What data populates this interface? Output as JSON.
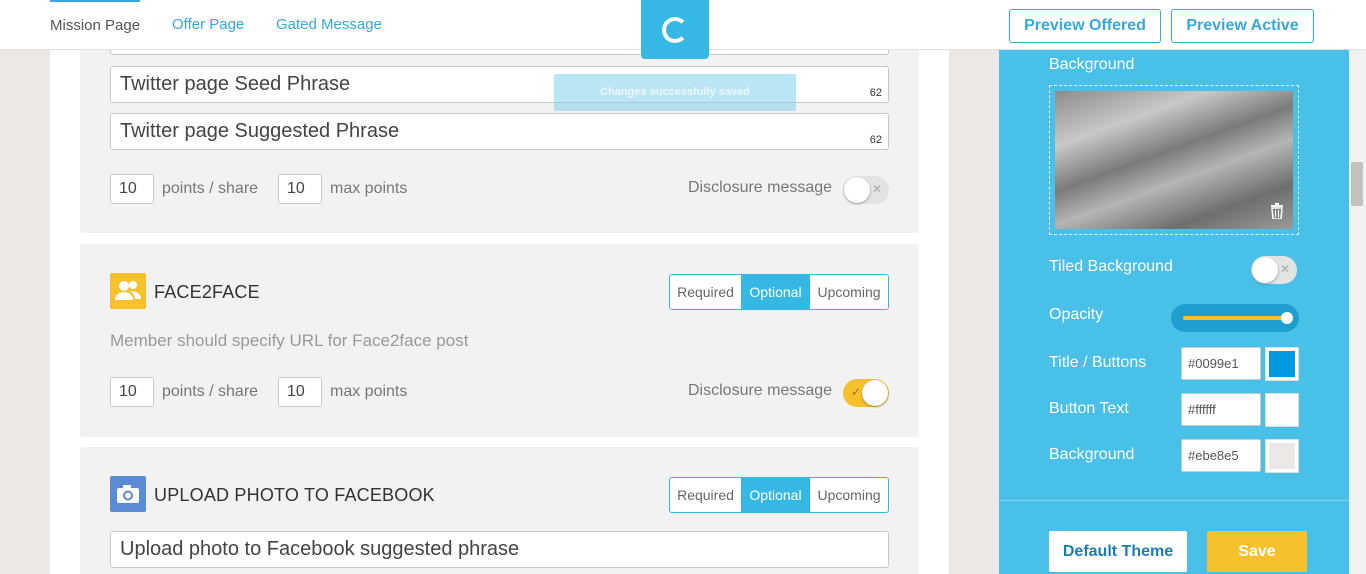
{
  "nav": {
    "tabs": [
      {
        "label": "Mission Page",
        "active": true
      },
      {
        "label": "Offer Page",
        "active": false
      },
      {
        "label": "Gated Message",
        "active": false
      }
    ],
    "preview_offered": "Preview Offered",
    "preview_active": "Preview Active"
  },
  "toast": "Changes successfully saved",
  "twitter": {
    "seed_phrase": "Twitter page Seed Phrase",
    "seed_count": "62",
    "suggested_phrase": "Twitter page Suggested Phrase",
    "suggested_count": "62",
    "points": "10",
    "points_label": "points / share",
    "max_points": "10",
    "max_label": "max points",
    "disclosure_label": "Disclosure message",
    "disclosure_on": false
  },
  "face2face": {
    "title": "FACE2FACE",
    "icon": "users-icon",
    "color": "#f7c12e",
    "options": [
      "Required",
      "Optional",
      "Upcoming"
    ],
    "selected": "Optional",
    "description": "Member should specify URL for Face2face post",
    "points": "10",
    "points_label": "points / share",
    "max_points": "10",
    "max_label": "max points",
    "disclosure_label": "Disclosure message",
    "disclosure_on": true
  },
  "upload_photo": {
    "title": "UPLOAD PHOTO TO FACEBOOK",
    "icon": "camera-icon",
    "color": "#5b8bd4",
    "options": [
      "Required",
      "Optional",
      "Upcoming"
    ],
    "selected": "Optional",
    "suggested_phrase": "Upload photo to Facebook suggested phrase"
  },
  "panel": {
    "background_label": "Background",
    "tiled_label": "Tiled Background",
    "tiled_on": false,
    "opacity_label": "Opacity",
    "opacity": 1.0,
    "title_buttons_label": "Title / Buttons",
    "title_buttons_hex": "#0099e1",
    "button_text_label": "Button Text",
    "button_text_hex": "#ffffff",
    "bg_color_label": "Background",
    "bg_color_hex": "#ebe8e5",
    "default_theme": "Default Theme",
    "save": "Save"
  },
  "colors": {
    "accent": "#36b8e5",
    "panel": "#48c0e7",
    "yellow": "#f7c12e"
  }
}
